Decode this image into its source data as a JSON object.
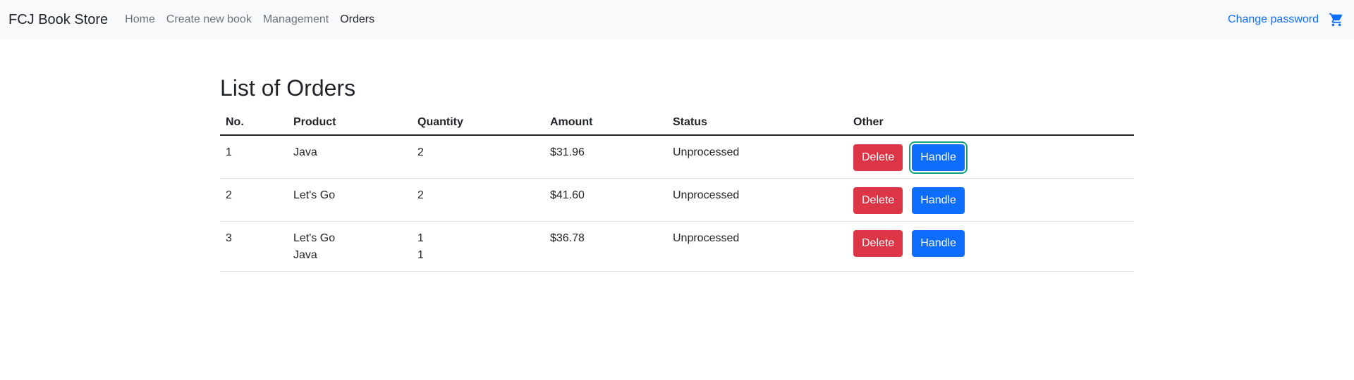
{
  "navbar": {
    "brand": "FCJ Book Store",
    "links": [
      {
        "label": "Home",
        "active": false
      },
      {
        "label": "Create new book",
        "active": false
      },
      {
        "label": "Management",
        "active": false
      },
      {
        "label": "Orders",
        "active": true
      }
    ],
    "change_password": "Change password",
    "cart_icon": "cart-icon"
  },
  "main": {
    "title": "List of Orders",
    "columns": [
      "No.",
      "Product",
      "Quantity",
      "Amount",
      "Status",
      "Other"
    ],
    "rows": [
      {
        "no": "1",
        "products": [
          "Java"
        ],
        "quantities": [
          "2"
        ],
        "amount": "$31.96",
        "status": "Unprocessed",
        "delete_label": "Delete",
        "handle_label": "Handle"
      },
      {
        "no": "2",
        "products": [
          "Let's Go"
        ],
        "quantities": [
          "2"
        ],
        "amount": "$41.60",
        "status": "Unprocessed",
        "delete_label": "Delete",
        "handle_label": "Handle"
      },
      {
        "no": "3",
        "products": [
          "Let's Go",
          "Java"
        ],
        "quantities": [
          "1",
          "1"
        ],
        "amount": "$36.78",
        "status": "Unprocessed",
        "delete_label": "Delete",
        "handle_label": "Handle"
      }
    ]
  },
  "colors": {
    "navbar_bg": "#f8f9fa",
    "link_blue": "#0d6efd",
    "delete_red": "#dc3545",
    "handle_blue": "#0d6efd",
    "highlight_green": "#10a37f"
  }
}
